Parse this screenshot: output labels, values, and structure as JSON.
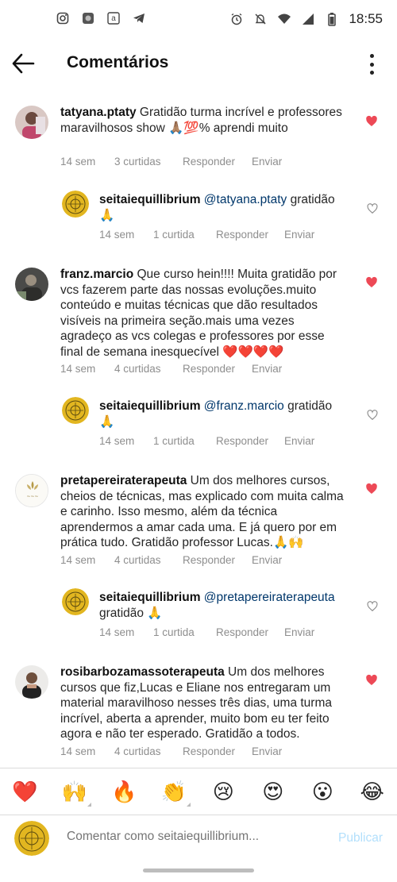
{
  "status_bar": {
    "time": "18:55",
    "left_icons": [
      "instagram-icon",
      "app-icon",
      "amazon-icon",
      "telegram-icon"
    ],
    "right_icons": [
      "alarm-icon",
      "mute-icon",
      "wifi-icon",
      "signal-icon",
      "battery-icon"
    ]
  },
  "header": {
    "title": "Comentários",
    "back_icon": "arrow-left-icon",
    "more_icon": "more-vertical-icon"
  },
  "comments": [
    {
      "username": "tatyana.ptaty",
      "text": " Gratidão  turma incrível e professores maravilhosos show 🙏🏽💯% aprendi muito",
      "time": "14 sem",
      "likes": "3 curtidas",
      "reply": "Responder",
      "send": "Enviar",
      "liked": true
    },
    {
      "username": "seitaiequillibrium",
      "mention": "@tatyana.ptaty",
      "text": " gratidão 🙏",
      "time": "14 sem",
      "likes": "1 curtida",
      "reply": "Responder",
      "send": "Enviar",
      "liked": false
    },
    {
      "username": "franz.marcio",
      "text": " Que curso hein!!!! Muita gratidão por vcs fazerem parte das nossas evoluções.muito conteúdo e muitas técnicas que dão resultados visíveis na primeira seção.mais uma vezes agradeço as vcs colegas e professores por esse final de semana inesquecível ❤️❤️❤️❤️",
      "time": "14 sem",
      "likes": "4 curtidas",
      "reply": "Responder",
      "send": "Enviar",
      "liked": true
    },
    {
      "username": "seitaiequillibrium",
      "mention": "@franz.marcio",
      "text": " gratidão 🙏",
      "time": "14 sem",
      "likes": "1 curtida",
      "reply": "Responder",
      "send": "Enviar",
      "liked": false
    },
    {
      "username": "pretapereiraterapeuta",
      "text": " Um dos melhores cursos, cheios de técnicas, mas explicado com muita calma e carinho. Isso mesmo, além da técnica aprendermos a amar cada uma. E já quero por em prática tudo. Gratidão professor Lucas.🙏🙌",
      "time": "14 sem",
      "likes": "4 curtidas",
      "reply": "Responder",
      "send": "Enviar",
      "liked": true
    },
    {
      "username": "seitaiequillibrium",
      "mention": "@pretapereiraterapeuta",
      "text": " gratidão 🙏",
      "time": "14 sem",
      "likes": "1 curtida",
      "reply": "Responder",
      "send": "Enviar",
      "liked": false
    },
    {
      "username": "rosibarbozamassoterapeuta",
      "text": " Um dos melhores cursos que fiz,Lucas e Eliane nos entregaram um material maravilhoso nesses três dias, uma turma incrível, aberta a aprender, muito bom eu ter feito agora e não ter esperado. Gratidão a todos.",
      "time": "14 sem",
      "likes": "4 curtidas",
      "reply": "Responder",
      "send": "Enviar",
      "liked": true
    }
  ],
  "reactions": [
    "❤️",
    "🙌",
    "🔥",
    "👏",
    "😢",
    "😍",
    "😮",
    "😂"
  ],
  "composer": {
    "placeholder": "Comentar como seitaiequillibrium...",
    "publish_label": "Publicar"
  },
  "colors": {
    "like_red": "#ed4956",
    "mention_blue": "#00376b",
    "meta_gray": "#8e8e8e",
    "publish_blue": "#b2dffc",
    "badge_gold": "#e2b620"
  }
}
